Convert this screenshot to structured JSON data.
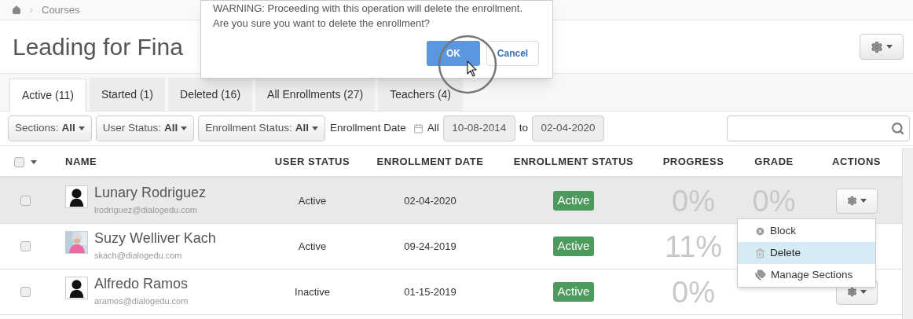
{
  "breadcrumb": {
    "items": [
      "Courses"
    ]
  },
  "page_title": "Leading for Fina",
  "dialog": {
    "message_lines": [
      "WARNING: Proceeding with this operation will delete the enrollment.",
      "Are you sure you want to delete the enrollment?"
    ],
    "buttons": [
      {
        "label": "OK",
        "kind": "primary"
      },
      {
        "label": "Cancel",
        "kind": "default"
      }
    ]
  },
  "tabs": [
    {
      "label": "Active (11)",
      "selected": true
    },
    {
      "label": "Started (1)",
      "selected": false
    },
    {
      "label": "Deleted (16)",
      "selected": false
    },
    {
      "label": "All Enrollments (27)",
      "selected": false
    },
    {
      "label": "Teachers (4)",
      "selected": false
    }
  ],
  "filters": [
    {
      "label": "Sections:",
      "value": "All"
    },
    {
      "label": "User Status:",
      "value": "All"
    },
    {
      "label": "Enrollment Status:",
      "value": "All"
    }
  ],
  "date_filter": {
    "label": "Enrollment Date",
    "all": "All",
    "from": "10-08-2014",
    "to_label": "to",
    "to": "02-04-2020"
  },
  "table": {
    "select_all_checked": false,
    "columns": [
      "NAME",
      "USER STATUS",
      "ENROLLMENT DATE",
      "ENROLLMENT STATUS",
      "PROGRESS",
      "GRADE",
      "ACTIONS"
    ],
    "rows": [
      {
        "name": "Lunary Rodriguez",
        "email": "lrodriguez@dialogedu.com",
        "avatar": {
          "kind": "silhouette"
        },
        "user_status": "Active",
        "enrollment_date": "02-04-2020",
        "enrollment_status": "Active",
        "progress": "0%",
        "grade": "0%",
        "checked": false,
        "highlighted": true,
        "action_button": true
      },
      {
        "name": "Suzy Welliver Kach",
        "email": "skach@dialogedu.com",
        "user_status": "Active",
        "enrollment_date": "09-24-2019",
        "enrollment_status": "Active",
        "progress": "11%",
        "checked": false,
        "highlighted": false
      },
      {
        "name": "Alfredo Ramos",
        "email": "aramos@dialogedu.com",
        "avatar": {
          "kind": "silhouette"
        },
        "user_status": "Inactive",
        "enrollment_date": "01-15-2019",
        "enrollment_status": "Active",
        "progress": "0%",
        "checked": false,
        "highlighted": false,
        "action_button": true
      }
    ]
  },
  "action_menu": {
    "items": [
      {
        "label": "Block",
        "kind": "block",
        "selected": false
      },
      {
        "label": "Delete",
        "kind": "delete",
        "selected": true
      },
      {
        "label": "Manage Sections",
        "kind": "sections",
        "selected": false
      }
    ]
  }
}
